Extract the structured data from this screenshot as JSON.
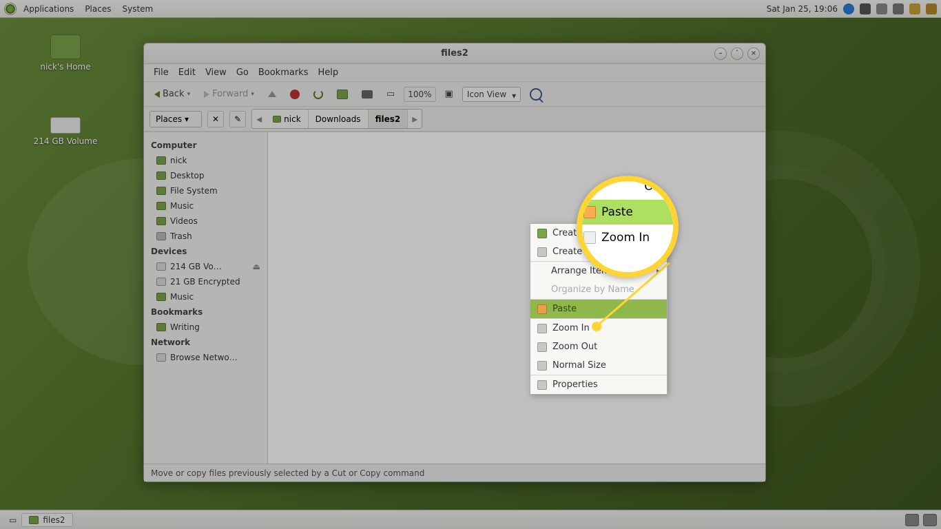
{
  "panel": {
    "apps": "Applications",
    "places": "Places",
    "system": "System",
    "clock": "Sat Jan 25, 19:06"
  },
  "desktop": {
    "home_label": "nick's Home",
    "volume_label": "214 GB Volume"
  },
  "window": {
    "title": "files2",
    "menubar": [
      "File",
      "Edit",
      "View",
      "Go",
      "Bookmarks",
      "Help"
    ],
    "back": "Back",
    "forward": "Forward",
    "zoom": "100%",
    "view": "Icon View",
    "places_btn": "Places",
    "breadcrumb": {
      "seg1": "nick",
      "seg2": "Downloads",
      "seg3": "files2"
    },
    "sidebar": {
      "computer": "Computer",
      "items1": [
        "nick",
        "Desktop",
        "File System",
        "Music",
        "Videos",
        "Trash"
      ],
      "devices": "Devices",
      "items2": [
        "214 GB Vo…",
        "21 GB Encrypted",
        "Music"
      ],
      "bookmarks": "Bookmarks",
      "items3": [
        "Writing"
      ],
      "network": "Network",
      "items4": [
        "Browse Netwo…"
      ]
    },
    "status": "Move or copy files previously selected by a Cut or Copy command"
  },
  "context_menu": {
    "create_folder": "Create Folder",
    "create_document": "Create Document",
    "arrange": "Arrange Items",
    "organize": "Organize by Name",
    "paste": "Paste",
    "zoom_in": "Zoom In",
    "zoom_out": "Zoom Out",
    "normal": "Normal Size",
    "properties": "Properties"
  },
  "magnifier": {
    "organize": "Organiz",
    "paste": "Paste",
    "zoom_in": "Zoom In"
  },
  "taskbar": {
    "item1": "files2"
  }
}
